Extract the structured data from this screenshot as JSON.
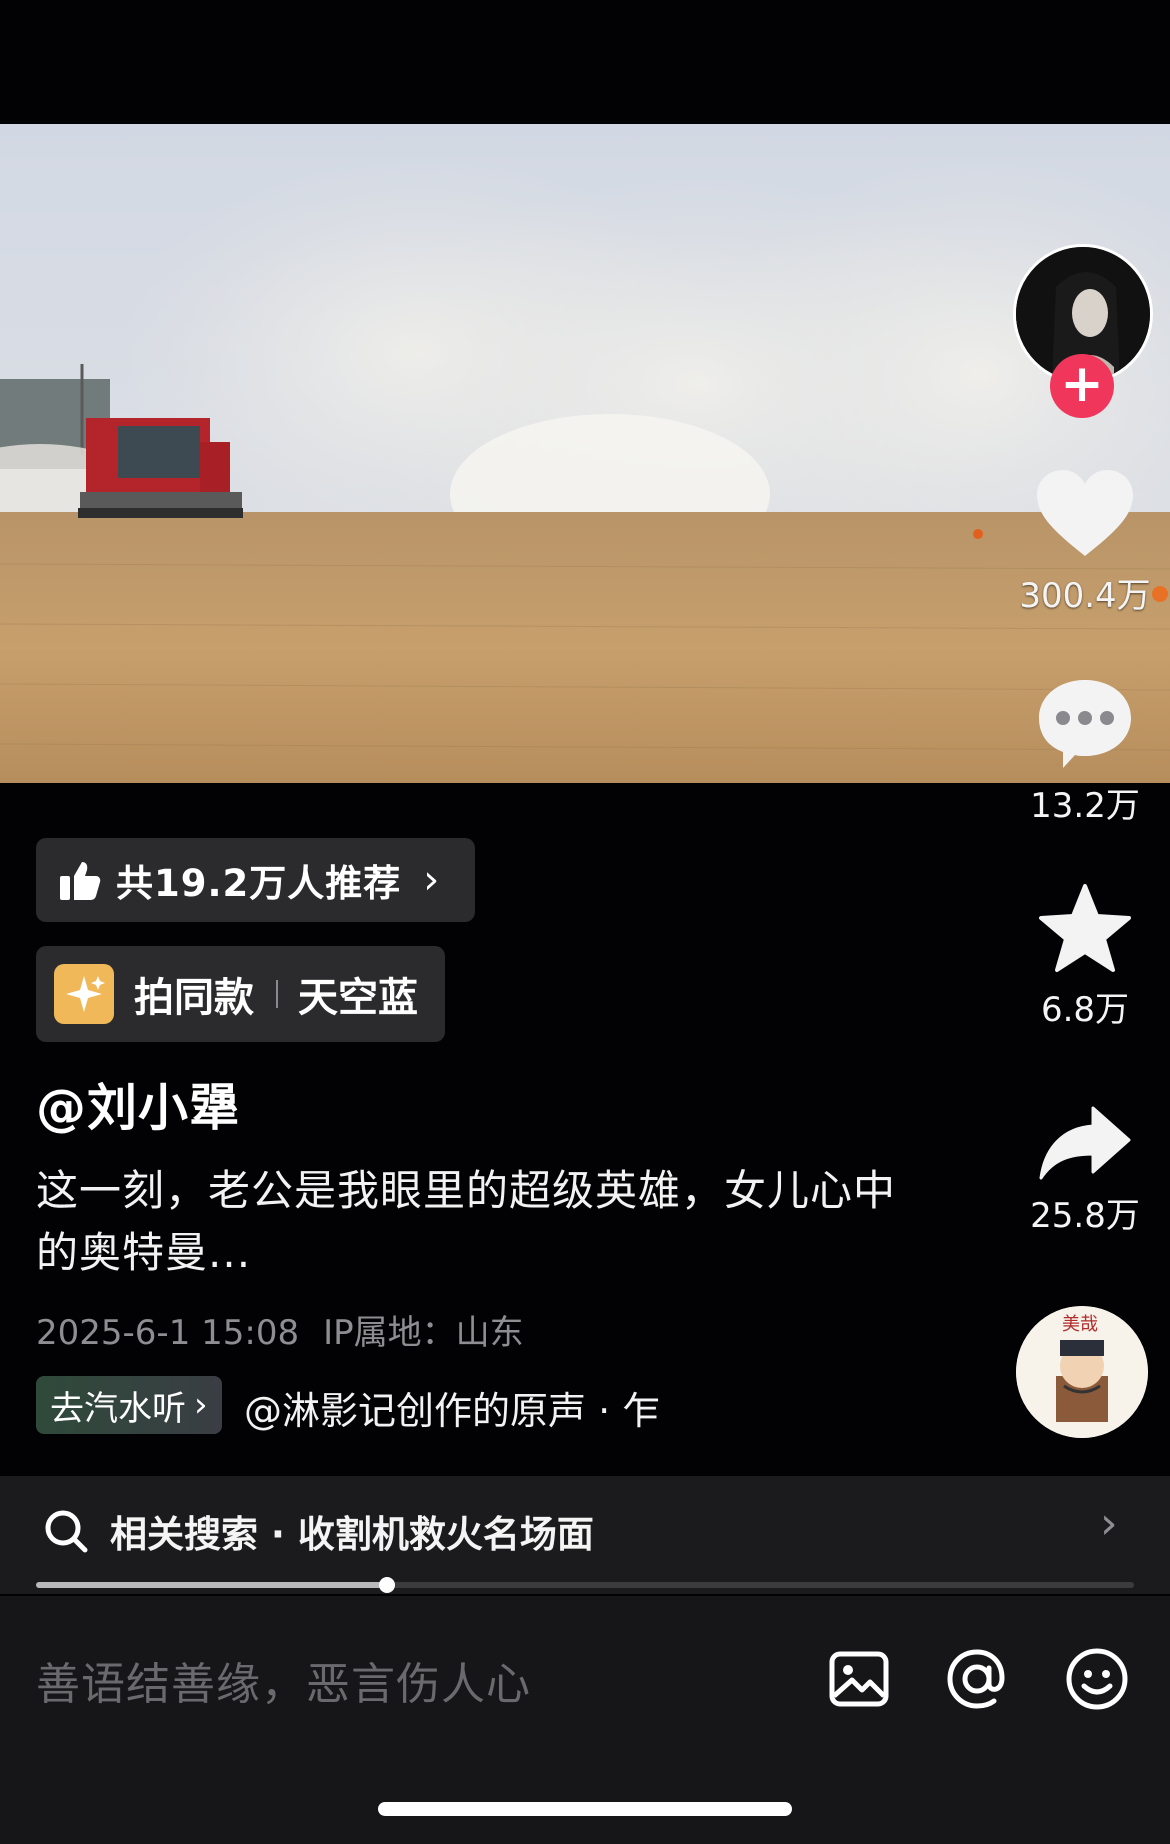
{
  "actions": {
    "like_count": "300.4万",
    "comment_count": "13.2万",
    "favorite_count": "6.8万",
    "share_count": "25.8万"
  },
  "recommend": {
    "label": "共19.2万人推荐"
  },
  "same_style": {
    "label": "拍同款",
    "name": "天空蓝"
  },
  "post": {
    "author": "@刘小犟",
    "caption": "这一刻，老公是我眼里的超级英雄，女儿心中的奥特曼...",
    "date": "2025-6-1 15:08",
    "ip": "IP属地：山东"
  },
  "music": {
    "listen_label": "去汽水听",
    "title": "@淋影记创作的原声 · 乍"
  },
  "disc_text": "美哉",
  "related_search": {
    "label": "相关搜索 · 收割机救火名场面",
    "progress": 0.32
  },
  "comment": {
    "placeholder": "善语结善缘，恶言伤人心"
  }
}
